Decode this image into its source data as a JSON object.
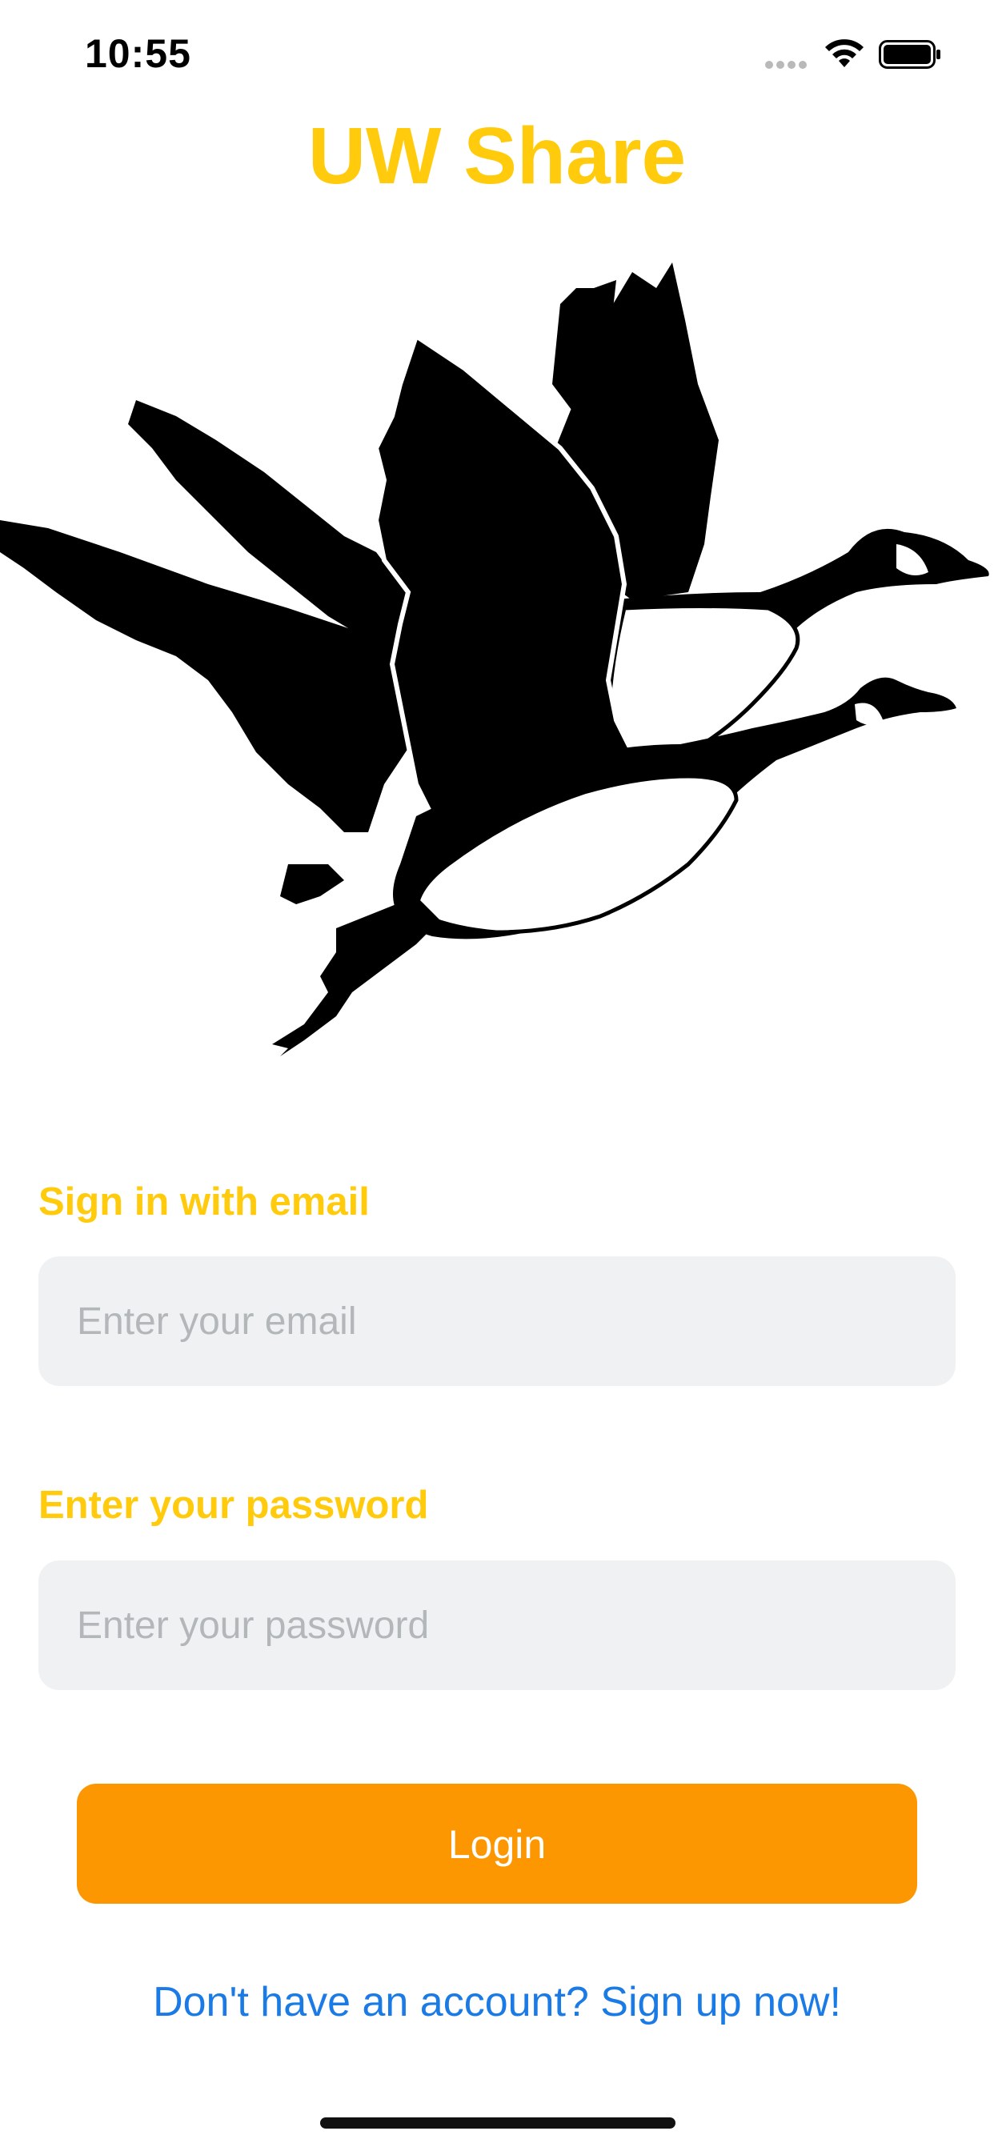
{
  "status_bar": {
    "time": "10:55",
    "icons": [
      "signal-dots-icon",
      "wifi-icon",
      "battery-icon"
    ]
  },
  "app": {
    "title": "UW Share",
    "logo": "canada-geese-logo"
  },
  "form": {
    "email_label": "Sign in with email",
    "email_placeholder": "Enter your email",
    "email_value": "",
    "password_label": "Enter your password",
    "password_placeholder": "Enter your password",
    "password_value": "",
    "login_label": "Login",
    "signup_link": "Don't have an account? Sign up now!"
  },
  "colors": {
    "brand_yellow": "#ffcb0c",
    "button_orange": "#fd9701",
    "link_blue": "#1b7be6",
    "field_background": "#eff1f2"
  }
}
